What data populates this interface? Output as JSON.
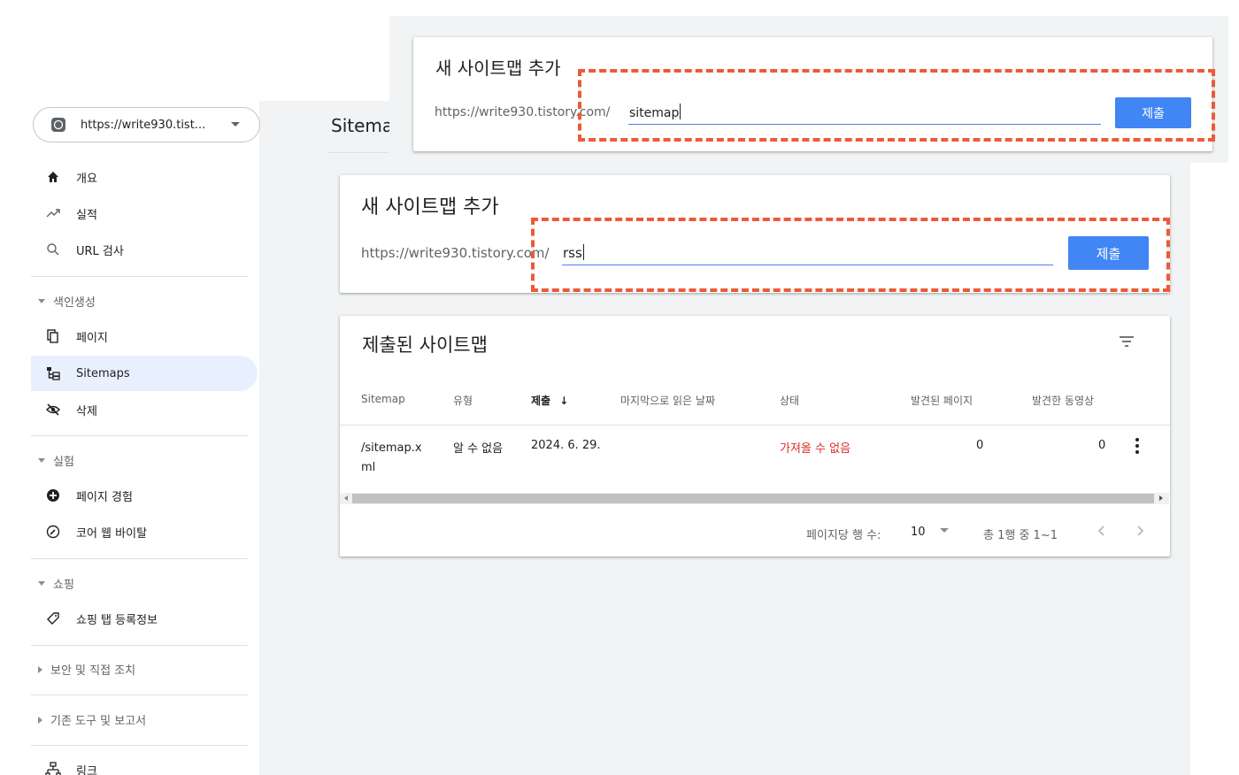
{
  "property": {
    "url": "https://write930.tist..."
  },
  "sidebar": {
    "items_top": [
      {
        "label": "개요",
        "icon": "home-icon"
      },
      {
        "label": "실적",
        "icon": "trending-up-icon"
      },
      {
        "label": "URL 검사",
        "icon": "search-icon"
      }
    ],
    "section_indexing": "색인생성",
    "items_indexing": [
      {
        "label": "페이지",
        "icon": "pages-icon"
      },
      {
        "label": "Sitemaps",
        "icon": "sitemap-icon",
        "active": true
      },
      {
        "label": "삭제",
        "icon": "eye-off-icon"
      }
    ],
    "section_experiments": "실험",
    "items_experiments": [
      {
        "label": "페이지 경험",
        "icon": "plus-circle-icon"
      },
      {
        "label": "코어 웹 바이탈",
        "icon": "gauge-icon"
      }
    ],
    "section_shopping": "쇼핑",
    "items_shopping": [
      {
        "label": "쇼핑 탭 등록정보",
        "icon": "tag-icon"
      }
    ],
    "section_security": "보안 및 직접 조치",
    "section_legacy": "기존 도구 및 보고서",
    "items_bottom": [
      {
        "label": "링크",
        "icon": "links-icon"
      }
    ]
  },
  "page": {
    "title": "Sitemaps"
  },
  "overlay_card": {
    "title": "새 사이트맵 추가",
    "url_prefix": "https://write930.tistory.com/",
    "input_value": "sitemap",
    "submit_label": "제출"
  },
  "add_card": {
    "title": "새 사이트맵 추가",
    "url_prefix": "https://write930.tistory.com/",
    "input_value": "rss",
    "submit_label": "제출"
  },
  "submitted": {
    "title": "제출된 사이트맵",
    "columns": [
      "Sitemap",
      "유형",
      "제출",
      "마지막으로 읽은 날짜",
      "상태",
      "발견된 페이지",
      "발견한 동영상"
    ],
    "sort_arrow": "↓",
    "rows": [
      {
        "sitemap_line1": "/sitemap.x",
        "sitemap_line2": "ml",
        "type": "알 수 없음",
        "submitted": "2024. 6. 29.",
        "last_read": "",
        "status": "가져올 수 없음",
        "pages": "0",
        "videos": "0"
      }
    ],
    "pager": {
      "rows_per_page_label": "페이지당 행 수:",
      "rows_per_page": "10",
      "range": "총 1행 중 1~1"
    }
  },
  "colors": {
    "accent": "#4285f4",
    "highlight": "#ec5a3a",
    "error": "#d93025"
  }
}
